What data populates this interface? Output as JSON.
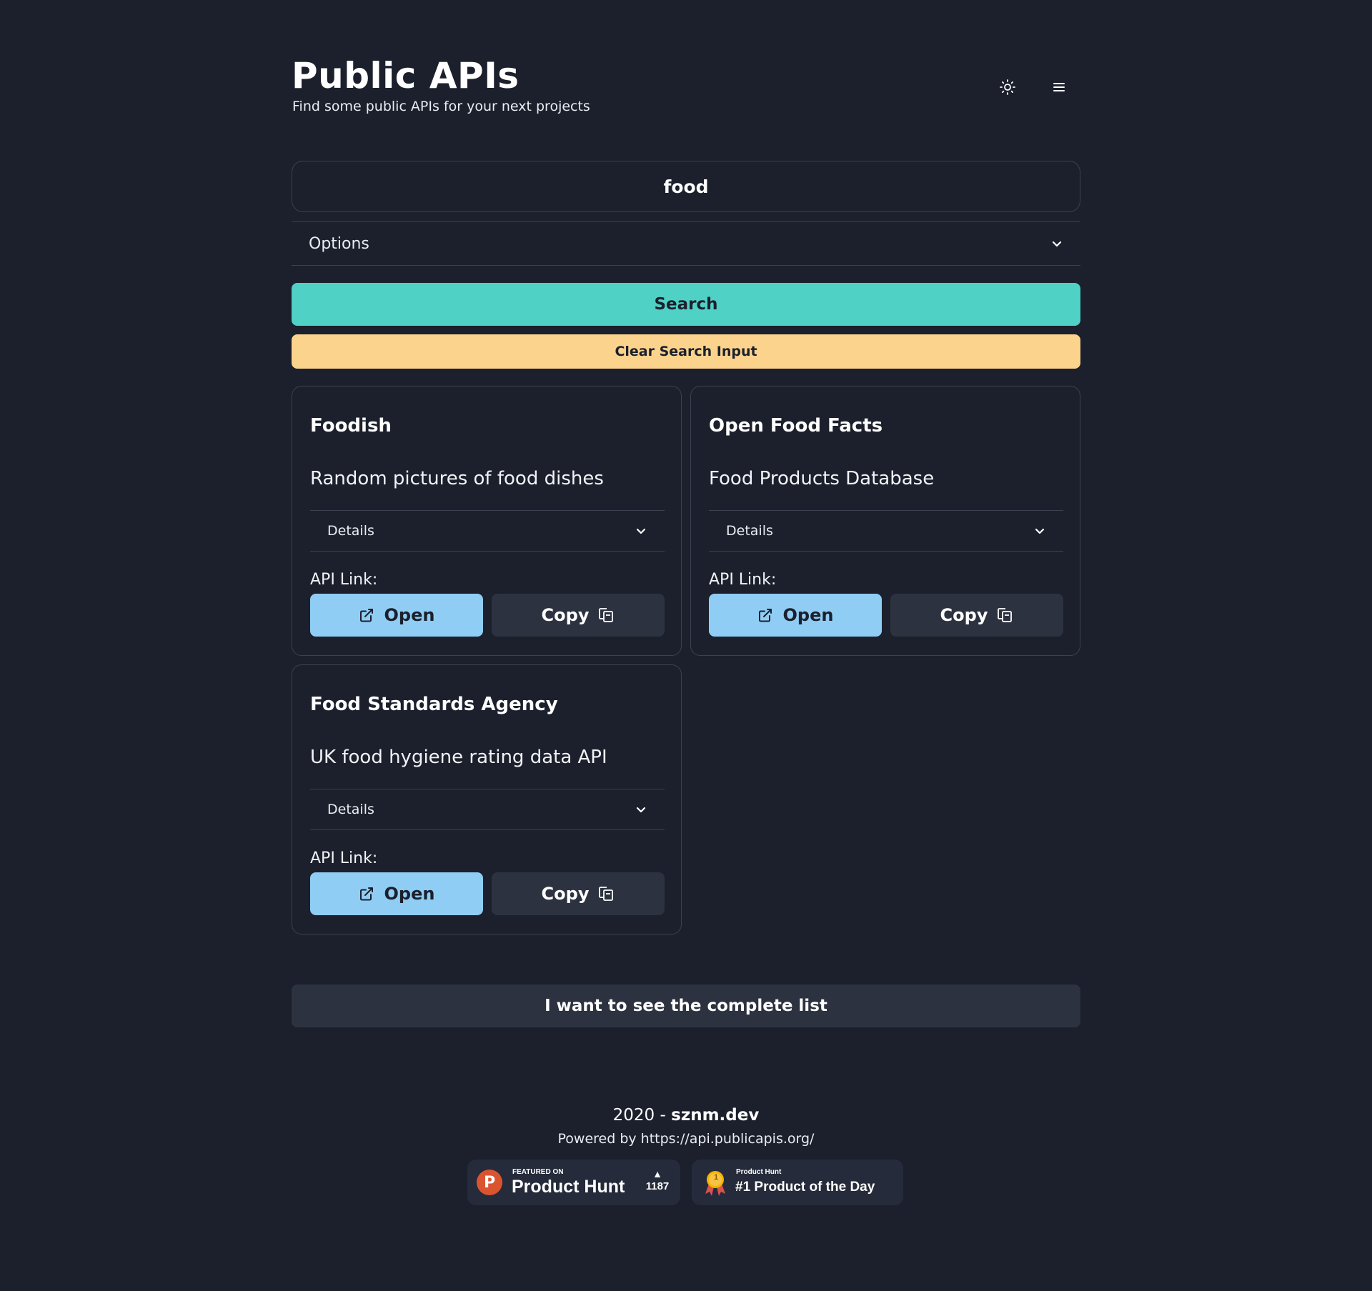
{
  "header": {
    "title": "Public APIs",
    "subtitle": "Find some public APIs for your next projects",
    "theme_icon": "sun-icon",
    "menu_icon": "hamburger-menu-icon"
  },
  "search": {
    "value": "food",
    "options_label": "Options",
    "search_button": "Search",
    "clear_button": "Clear Search Input"
  },
  "results": [
    {
      "title": "Foodish",
      "description": "Random pictures of food dishes",
      "details_label": "Details",
      "api_link_label": "API Link:",
      "open_label": "Open",
      "copy_label": "Copy"
    },
    {
      "title": "Open Food Facts",
      "description": "Food Products Database",
      "details_label": "Details",
      "api_link_label": "API Link:",
      "open_label": "Open",
      "copy_label": "Copy"
    },
    {
      "title": "Food Standards Agency",
      "description": "UK food hygiene rating data API",
      "details_label": "Details",
      "api_link_label": "API Link:",
      "open_label": "Open",
      "copy_label": "Copy"
    }
  ],
  "complete_list_button": "I want to see the complete list",
  "footer": {
    "year": "2020 -",
    "brand": "sznm.dev",
    "powered_by": "Powered by https://api.publicapis.org/",
    "product_hunt_badge": {
      "featured_on": "FEATURED ON",
      "name": "Product Hunt",
      "logo_letter": "P",
      "upvotes": "1187"
    },
    "product_of_day_badge": {
      "small": "Product Hunt",
      "big": "#1 Product of the Day",
      "medal_number": "1"
    }
  },
  "colors": {
    "background": "#1b202c",
    "search_button": "#4fd1c5",
    "clear_button": "#fbd38d",
    "open_button": "#90cdf4",
    "copy_button": "#2d3240",
    "product_hunt": "#da552f"
  }
}
